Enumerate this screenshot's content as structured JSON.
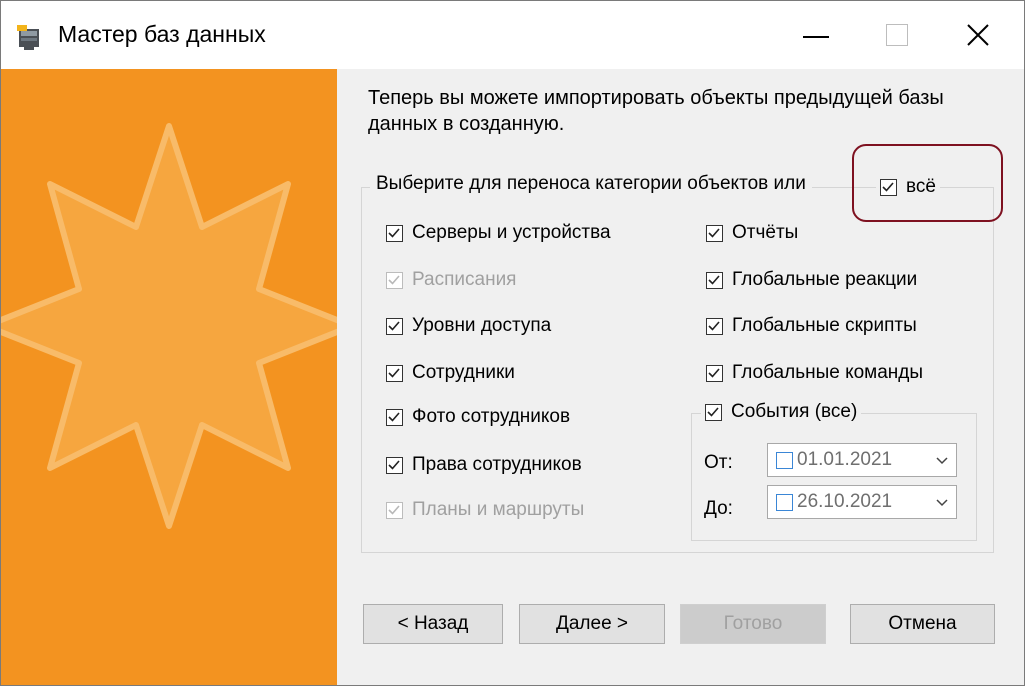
{
  "window": {
    "title": "Мастер баз данных"
  },
  "titlebar": {
    "minimize_icon": "minimize-icon",
    "maximize_icon": "maximize-icon",
    "close_icon": "close-icon"
  },
  "colors": {
    "sidebar": "#f39320",
    "highlight": "#7e1120",
    "date_checkbox": "#3a86d6"
  },
  "intro_text": "Теперь вы можете импортировать объекты предыдущей базы данных в созданную.",
  "categories": {
    "caption": "Выберите для переноса категории объектов или",
    "all_label": "всё",
    "all_checked": true,
    "left": [
      {
        "label": "Серверы и устройства",
        "checked": true,
        "enabled": true
      },
      {
        "label": "Расписания",
        "checked": true,
        "enabled": false
      },
      {
        "label": "Уровни доступа",
        "checked": true,
        "enabled": true
      },
      {
        "label": "Сотрудники",
        "checked": true,
        "enabled": true
      },
      {
        "label": "Фото сотрудников",
        "checked": true,
        "enabled": true
      },
      {
        "label": "Права сотрудников",
        "checked": true,
        "enabled": true
      },
      {
        "label": "Планы и маршруты",
        "checked": true,
        "enabled": false
      }
    ],
    "right": [
      {
        "label": "Отчёты",
        "checked": true,
        "enabled": true
      },
      {
        "label": "Глобальные реакции",
        "checked": true,
        "enabled": true
      },
      {
        "label": "Глобальные скрипты",
        "checked": true,
        "enabled": true
      },
      {
        "label": "Глобальные команды",
        "checked": true,
        "enabled": true
      }
    ]
  },
  "events": {
    "label": "События (все)",
    "checked": true,
    "from_label": "От:",
    "to_label": "До:",
    "from_date": "01.01.2021",
    "to_date": "26.10.2021"
  },
  "buttons": {
    "back": "< Назад",
    "next": "Далее >",
    "finish": "Готово",
    "cancel": "Отмена"
  }
}
